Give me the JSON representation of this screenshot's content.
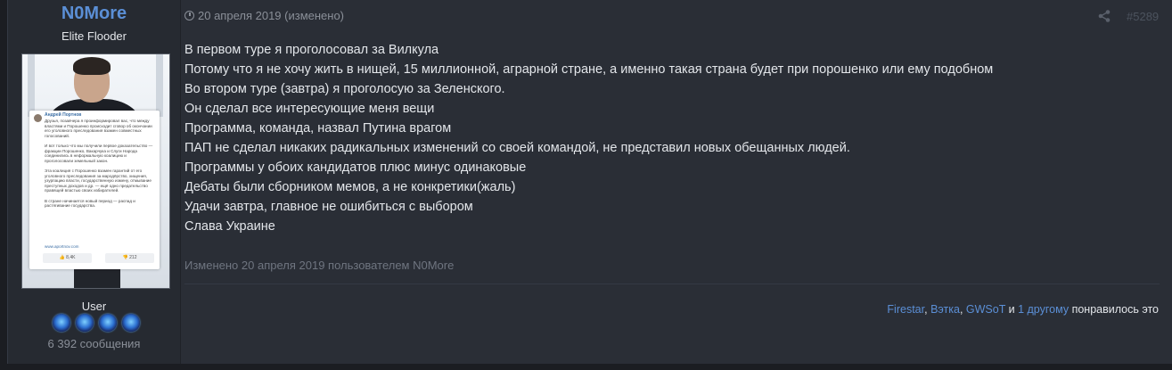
{
  "author": {
    "username": "N0More",
    "title": "Elite Flooder",
    "role": "User",
    "message_count": "6 392 сообщения",
    "badges": [
      "badge-icon",
      "badge-icon",
      "badge-icon",
      "badge-icon"
    ],
    "avatar_card": {
      "name": "Андрей Портнов",
      "text": "Друзья, позавчера я проинформировал вас, что между властями и Порошенко происходит сговор об окончании его уголовного преследования взамен совместных голосований.\n\nИ вот только что мы получили первое доказательство — фракции Порошенко, Вакарчука и Слуги Народа соединились в неформальную коалицию и проголосовали земельный закон.\n\nЭта коалиция с Порошенко взамен гарантий от его уголовного преследования за мародёрство, хищения, узурпацию власти, государственную измену, отмывание преступных доходов и др. — ещё одно предательство правящей властью своих избирателей.\n\nВ стране начинается новый период — распад и растягивание государства.",
      "link": "www.aportnov.com",
      "likes": "8,4K",
      "dislikes": "212"
    }
  },
  "post": {
    "date": "20 апреля 2019 (изменено)",
    "number": "#5289",
    "lines": [
      "В первом туре я проголосовал за Вилкула",
      "Потому что я не хочу жить в нищей, 15 миллионной, аграрной стране, а именно такая страна будет при порошенко или ему подобном",
      "Во втором туре (завтра) я проголосую за Зеленского.",
      "Он сделал все интересующие меня вещи",
      "Программа, команда, назвал Путина врагом",
      "ПАП не сделал никаких радикальных изменений со своей командой, не представил новых обещанных людей.",
      "Программы у обоих кандидатов плюс минус одинаковые",
      "Дебаты были сборником мемов, а не конкретики(жаль)",
      "Удачи завтра, главное не ошибиться с выбором",
      "Слава Украине"
    ],
    "edited_note": "Изменено 20 апреля 2019 пользователем N0More"
  },
  "reactions": {
    "users": [
      "Firestar",
      "Вэтка",
      "GWSoT"
    ],
    "and": "и",
    "others": "1 другому",
    "suffix": "понравилось это"
  },
  "colors": {
    "background": "#1b1d22",
    "post": "#2a2e36",
    "link": "#5b8fd6",
    "text": "#e3e6ea",
    "muted": "#8a8f98"
  }
}
